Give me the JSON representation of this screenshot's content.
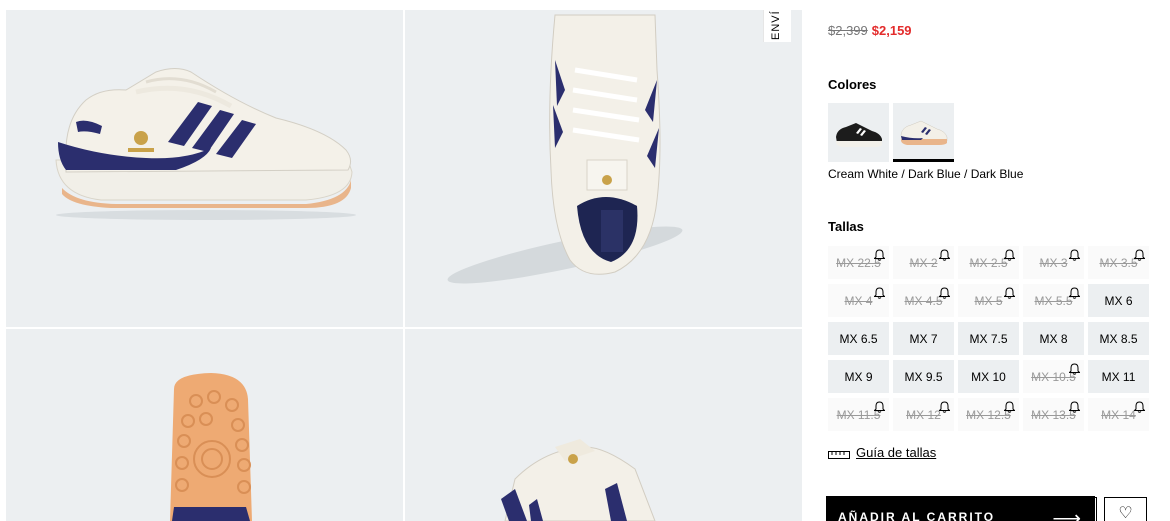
{
  "shipping_tab": "ENVÍ",
  "price": {
    "original": "$2,399",
    "sale": "$2,159"
  },
  "colors": {
    "heading": "Colores",
    "selected_name": "Cream White / Dark Blue / Dark Blue",
    "swatches": [
      {
        "name": "black-white-variant",
        "selected": false
      },
      {
        "name": "cream-white-dark-blue-variant",
        "selected": true
      }
    ]
  },
  "sizes": {
    "heading": "Tallas",
    "items": [
      {
        "label": "MX 22.5",
        "available": false
      },
      {
        "label": "MX 2",
        "available": false
      },
      {
        "label": "MX 2.5",
        "available": false
      },
      {
        "label": "MX 3",
        "available": false
      },
      {
        "label": "MX 3.5",
        "available": false
      },
      {
        "label": "MX 4",
        "available": false
      },
      {
        "label": "MX 4.5",
        "available": false
      },
      {
        "label": "MX 5",
        "available": false
      },
      {
        "label": "MX 5.5",
        "available": false
      },
      {
        "label": "MX 6",
        "available": true
      },
      {
        "label": "MX 6.5",
        "available": true
      },
      {
        "label": "MX 7",
        "available": true
      },
      {
        "label": "MX 7.5",
        "available": true
      },
      {
        "label": "MX 8",
        "available": true
      },
      {
        "label": "MX 8.5",
        "available": true
      },
      {
        "label": "MX 9",
        "available": true
      },
      {
        "label": "MX 9.5",
        "available": true
      },
      {
        "label": "MX 10",
        "available": true
      },
      {
        "label": "MX 10.5",
        "available": false
      },
      {
        "label": "MX 11",
        "available": true
      },
      {
        "label": "MX 11.5",
        "available": false
      },
      {
        "label": "MX 12",
        "available": false
      },
      {
        "label": "MX 12.5",
        "available": false
      },
      {
        "label": "MX 13.5",
        "available": false
      },
      {
        "label": "MX 14",
        "available": false
      }
    ]
  },
  "size_guide": {
    "label": "Guía de tallas",
    "icon": "ruler-icon"
  },
  "add_to_cart": {
    "label": "AÑADIR AL CARRITO",
    "arrow": "⟶"
  },
  "wishlist": {
    "icon": "heart-icon",
    "glyph": "♡"
  },
  "style": {
    "sale_color": "#e32b2b",
    "navy_stripe": "#2b2e6e",
    "tile_bg": "#eceff1"
  }
}
